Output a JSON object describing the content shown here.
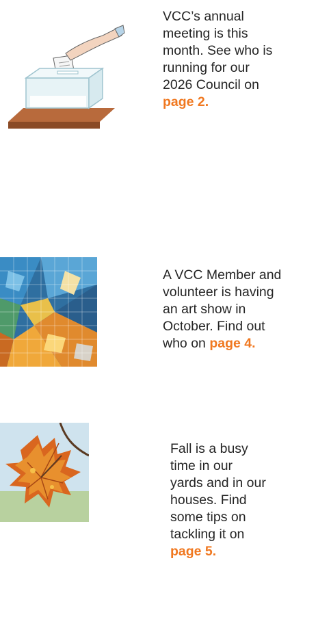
{
  "stories": [
    {
      "lines": [
        "VCC’s annual",
        "meeting is this",
        "month. See who is",
        "running for our",
        "2026 Council on"
      ],
      "page_ref": "page 2.",
      "image_icon": "ballot-box-icon"
    },
    {
      "lines": [
        "A VCC Member and",
        "volunteer is having",
        "an art show in",
        "October. Find out",
        "who on "
      ],
      "page_ref": "page 4.",
      "image_icon": "mosaic-art-icon"
    },
    {
      "lines": [
        "Fall is a busy",
        "time in our",
        "yards and in our",
        "houses. Find",
        "some tips on",
        "tackling it on"
      ],
      "page_ref": "page 5.",
      "image_icon": "autumn-leaf-icon"
    }
  ],
  "colors": {
    "accent": "#f07820",
    "text": "#252525"
  }
}
